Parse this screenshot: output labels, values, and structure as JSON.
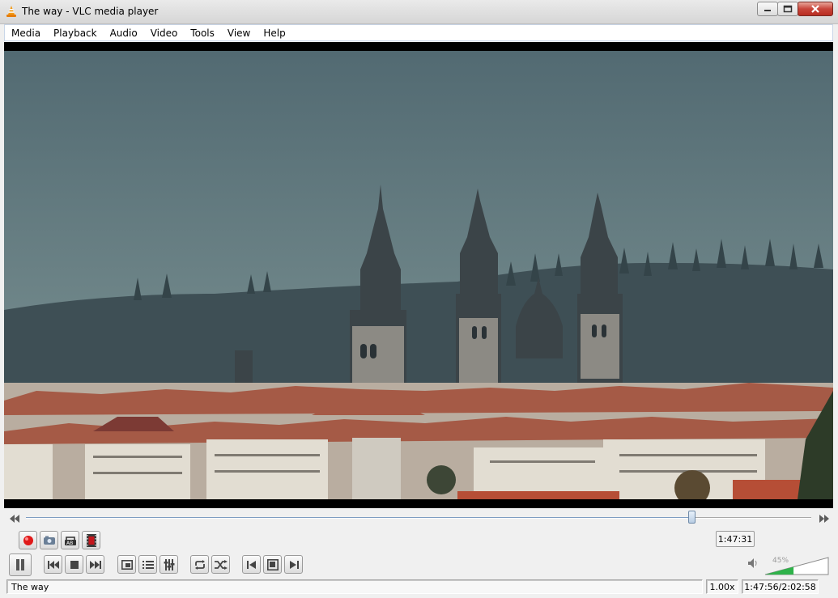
{
  "window": {
    "title": "The way - VLC media player"
  },
  "menu": [
    "Media",
    "Playback",
    "Audio",
    "Video",
    "Tools",
    "View",
    "Help"
  ],
  "seek": {
    "position": 0.8476,
    "tooltip": "1:47:31"
  },
  "controls": {
    "advanced": [
      "record-icon",
      "snapshot-icon",
      "loop-ab-icon",
      "frame-by-frame-icon"
    ],
    "main": [
      "pause-icon",
      "previous-icon",
      "stop-icon",
      "next-icon",
      "fullscreen-icon",
      "playlist-icon",
      "extended-settings-icon",
      "loop-icon",
      "shuffle-icon",
      "previous-frame-icon",
      "toggle-video-icon",
      "next-frame-icon"
    ]
  },
  "volume": {
    "level": 0.45,
    "label": "45%"
  },
  "status": {
    "media_title": "The way",
    "speed": "1.00x",
    "time": "1:47:56/2:02:58"
  },
  "colors": {
    "accent_green": "#2fb24a",
    "record_red": "#e01a1a",
    "close_red": "#c8453a"
  }
}
